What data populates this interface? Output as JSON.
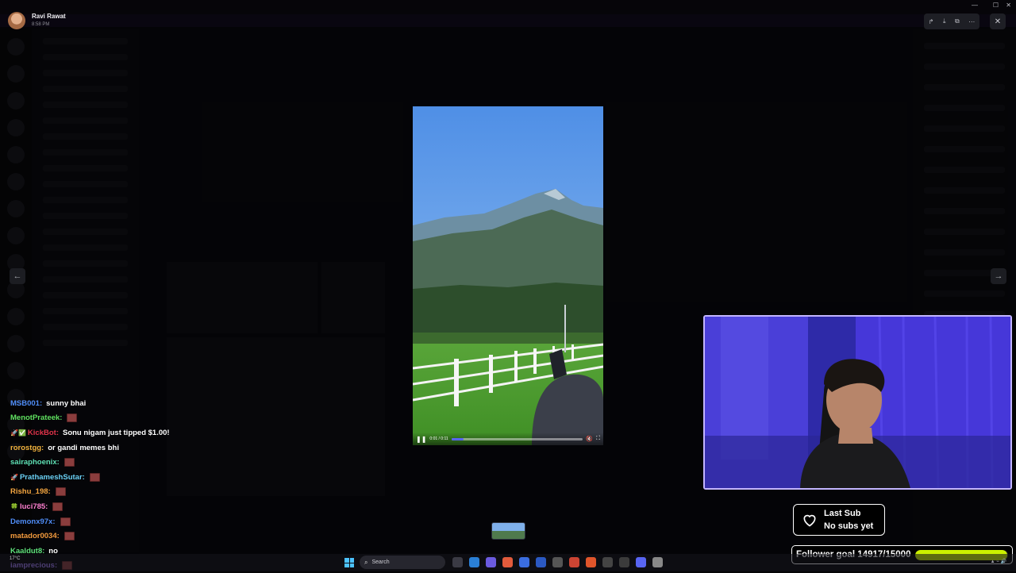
{
  "viewer": {
    "user_name": "Ravi Rawat",
    "time": "8:58 PM",
    "icons": [
      "share-icon",
      "download-icon",
      "open-external-icon",
      "more-icon"
    ],
    "close_icon": "close-icon"
  },
  "video": {
    "current_time": "0:01",
    "duration": "0:11",
    "time_text": "0:01 / 0:11",
    "progress": 0.09,
    "buffered": 0.3
  },
  "chat": [
    {
      "badges": "",
      "user": "MSB001:",
      "color": "#4f8df7",
      "text": "sunny bhai",
      "emote": false
    },
    {
      "badges": "",
      "user": "MenotPrateek:",
      "color": "#5fe05f",
      "text": "",
      "emote": true
    },
    {
      "badges": "🚀✅",
      "user": "KickBot:",
      "color": "#e0334a",
      "text": "Sonu nigam just tipped $1.00!",
      "emote": false
    },
    {
      "badges": "",
      "user": "rorostgg:",
      "color": "#f2b33d",
      "text": "or gandi memes bhi",
      "emote": false
    },
    {
      "badges": "",
      "user": "sairaphoenix:",
      "color": "#5ee0b4",
      "text": "",
      "emote": true
    },
    {
      "badges": "🚀",
      "user": "PrathameshSutar:",
      "color": "#6ad1f5",
      "text": "",
      "emote": true
    },
    {
      "badges": "",
      "user": "Rishu_198:",
      "color": "#f5a640",
      "text": "",
      "emote": true
    },
    {
      "badges": "🍀",
      "user": "luci785:",
      "color": "#ff7fd0",
      "text": "",
      "emote": true
    },
    {
      "badges": "",
      "user": "Demonx97x:",
      "color": "#4f8df7",
      "text": "",
      "emote": true
    },
    {
      "badges": "",
      "user": "matador0034:",
      "color": "#f29a3d",
      "text": "",
      "emote": true
    },
    {
      "badges": "",
      "user": "Kaaldut8:",
      "color": "#5ee07a",
      "text": "no",
      "emote": false
    },
    {
      "badges": "",
      "user": "iamprecious:",
      "color": "#a07cf5",
      "text": "",
      "emote": true
    }
  ],
  "last_sub": {
    "title": "Last Sub",
    "value": "No subs yet"
  },
  "follower_goal": {
    "label": "Follower goal 14917/15000",
    "current": 14917,
    "target": 15000
  },
  "taskbar": {
    "weather": "17°C",
    "search_placeholder": "Search"
  },
  "colors": {
    "accent": "#5865f2",
    "goal_bar": "#ccf000",
    "webcam_border": "#c3b5ff"
  }
}
